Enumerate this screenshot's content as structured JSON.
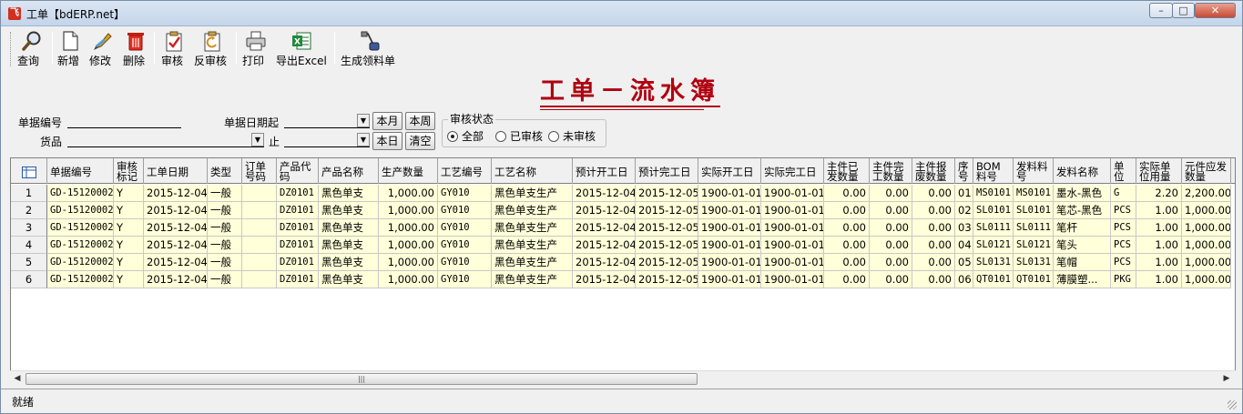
{
  "window": {
    "title": "工单【bdERP.net】",
    "min": "–",
    "max": "□",
    "close": "✕"
  },
  "toolbar": {
    "query": "查询",
    "new": "新增",
    "edit": "修改",
    "delete": "删除",
    "approve": "审核",
    "unapprove": "反审核",
    "print": "打印",
    "export": "导出Excel",
    "generate": "生成领料单"
  },
  "form": {
    "title": "工单－流水簿",
    "doc_no_label": "单据编号",
    "date_from_label": "单据日期起",
    "goods_label": "货品",
    "to_label": "止",
    "btn_month": "本月",
    "btn_week": "本周",
    "btn_today": "本日",
    "btn_clear": "清空",
    "status_group": "审核状态",
    "radio_all": "全部",
    "radio_approved": "已审核",
    "radio_unapproved": "未审核",
    "radio_selected": "全部"
  },
  "grid": {
    "headers": [
      "",
      "单据编号",
      "审核标记",
      "工单日期",
      "类型",
      "订单号码",
      "产品代码",
      "产品名称",
      "生产数量",
      "工艺编号",
      "工艺名称",
      "预计开工日",
      "预计完工日",
      "实际开工日",
      "实际完工日",
      "主件已发数量",
      "主件完工数量",
      "主件报废数量",
      "序号",
      "BOM料号",
      "发料料号",
      "发料名称",
      "单位",
      "实际单位用量",
      "元件应发数量"
    ],
    "rows": [
      [
        "1",
        "GD-15120002",
        "Y",
        "2015-12-04",
        "一般",
        "",
        "DZ0101",
        "黑色单支",
        "1,000.00",
        "GY010",
        "黑色单支生产",
        "2015-12-04",
        "2015-12-05",
        "1900-01-01",
        "1900-01-01",
        "0.00",
        "0.00",
        "0.00",
        "01",
        "MS0101",
        "MS0101",
        "墨水-黑色",
        "G",
        "2.20",
        "2,200.00"
      ],
      [
        "2",
        "GD-15120002",
        "Y",
        "2015-12-04",
        "一般",
        "",
        "DZ0101",
        "黑色单支",
        "1,000.00",
        "GY010",
        "黑色单支生产",
        "2015-12-04",
        "2015-12-05",
        "1900-01-01",
        "1900-01-01",
        "0.00",
        "0.00",
        "0.00",
        "02",
        "SL0101",
        "SL0101",
        "笔芯-黑色",
        "PCS",
        "1.00",
        "1,000.00"
      ],
      [
        "3",
        "GD-15120002",
        "Y",
        "2015-12-04",
        "一般",
        "",
        "DZ0101",
        "黑色单支",
        "1,000.00",
        "GY010",
        "黑色单支生产",
        "2015-12-04",
        "2015-12-05",
        "1900-01-01",
        "1900-01-01",
        "0.00",
        "0.00",
        "0.00",
        "03",
        "SL0111",
        "SL0111",
        "笔杆",
        "PCS",
        "1.00",
        "1,000.00"
      ],
      [
        "4",
        "GD-15120002",
        "Y",
        "2015-12-04",
        "一般",
        "",
        "DZ0101",
        "黑色单支",
        "1,000.00",
        "GY010",
        "黑色单支生产",
        "2015-12-04",
        "2015-12-05",
        "1900-01-01",
        "1900-01-01",
        "0.00",
        "0.00",
        "0.00",
        "04",
        "SL0121",
        "SL0121",
        "笔头",
        "PCS",
        "1.00",
        "1,000.00"
      ],
      [
        "5",
        "GD-15120002",
        "Y",
        "2015-12-04",
        "一般",
        "",
        "DZ0101",
        "黑色单支",
        "1,000.00",
        "GY010",
        "黑色单支生产",
        "2015-12-04",
        "2015-12-05",
        "1900-01-01",
        "1900-01-01",
        "0.00",
        "0.00",
        "0.00",
        "05",
        "SL0131",
        "SL0131",
        "笔帽",
        "PCS",
        "1.00",
        "1,000.00"
      ],
      [
        "6",
        "GD-15120002",
        "Y",
        "2015-12-04",
        "一般",
        "",
        "DZ0101",
        "黑色单支",
        "1,000.00",
        "GY010",
        "黑色单支生产",
        "2015-12-04",
        "2015-12-05",
        "1900-01-01",
        "1900-01-01",
        "0.00",
        "0.00",
        "0.00",
        "06",
        "QT0101",
        "QT0101",
        "薄膜塑...",
        "PKG",
        "1.00",
        "1,000.00"
      ]
    ]
  },
  "status": {
    "text": "就绪"
  },
  "colors": {
    "title_red": "#b00010",
    "row_bg": "#ffffd9"
  },
  "icons": {
    "query": "magnifier-icon",
    "new": "new-document-icon",
    "edit": "pen-icon",
    "delete": "trash-icon",
    "approve": "approve-check-icon",
    "unapprove": "undo-approve-icon",
    "print": "printer-icon",
    "export": "excel-icon",
    "generate": "generate-icon"
  }
}
